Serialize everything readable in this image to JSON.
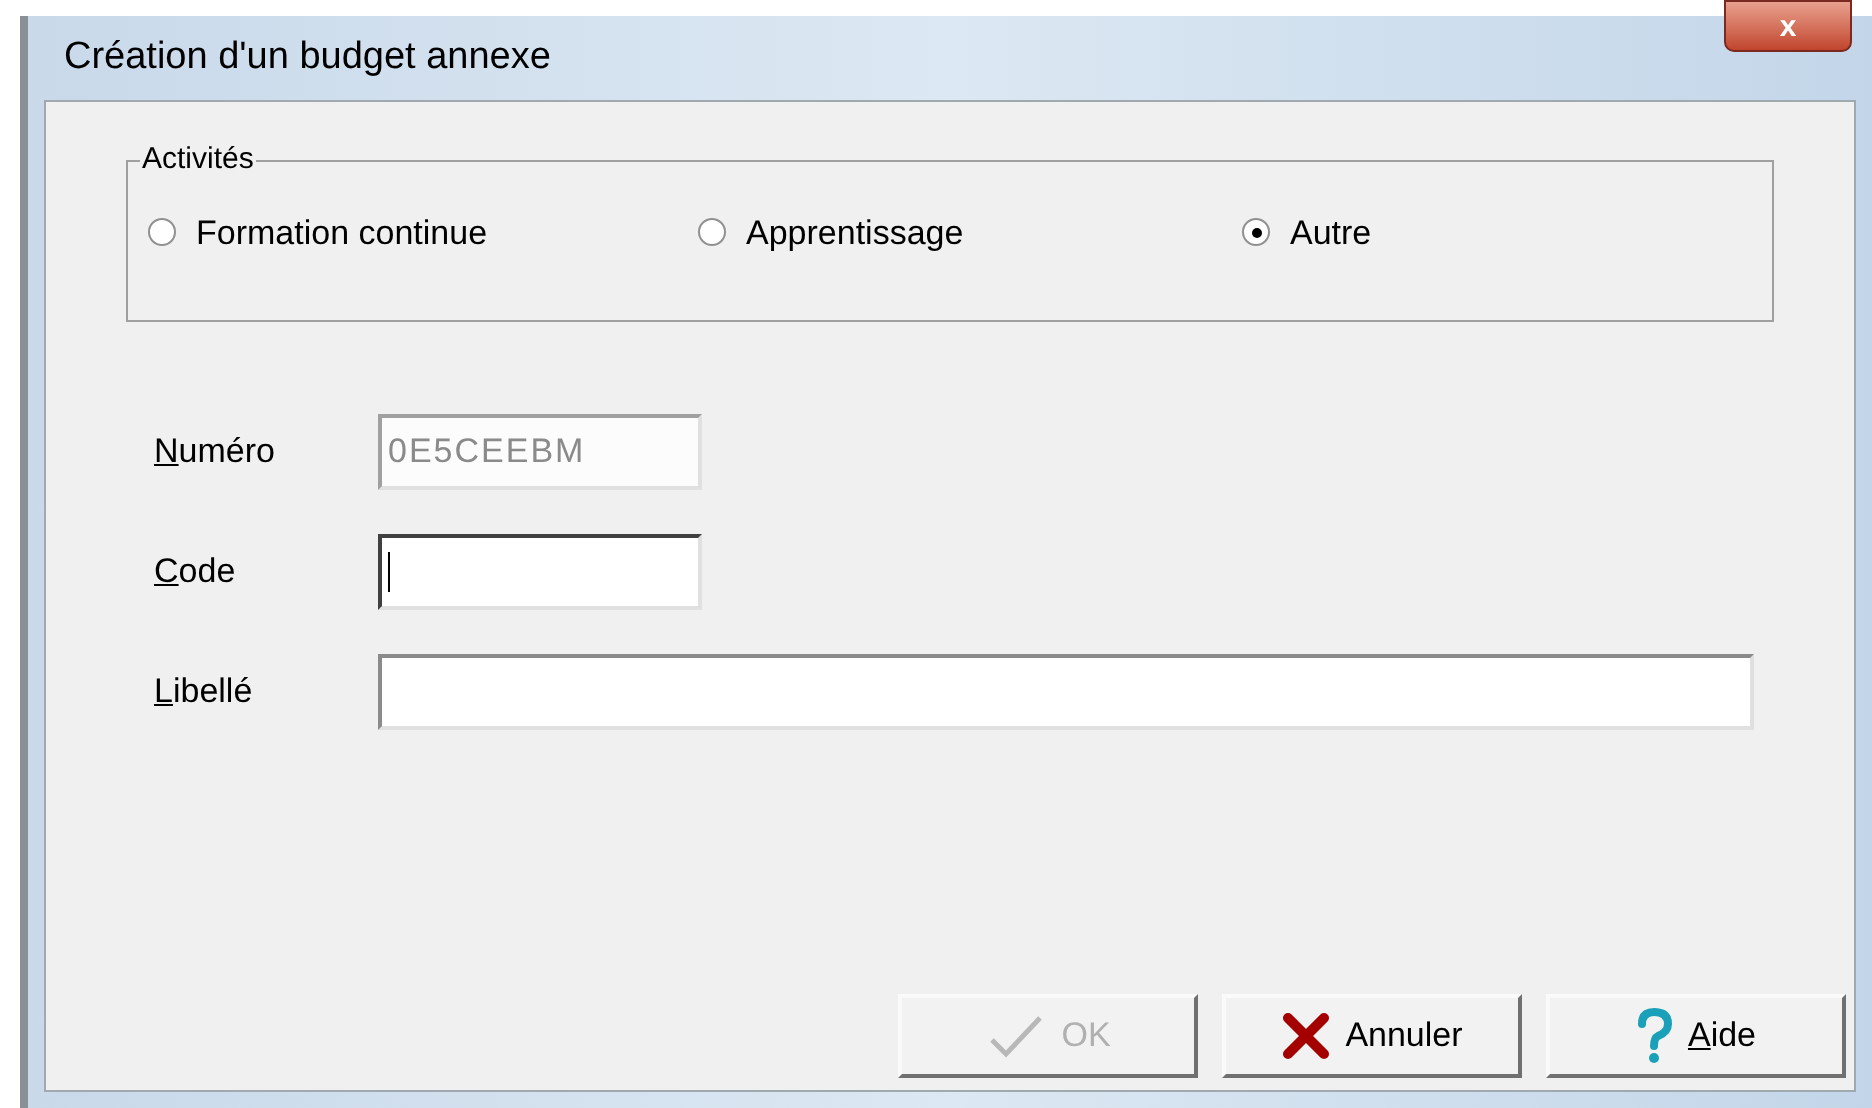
{
  "window": {
    "title": "Création d'un budget annexe",
    "close": "x"
  },
  "activities": {
    "legend": "Activités",
    "options": [
      {
        "label": "Formation continue",
        "selected": false
      },
      {
        "label": "Apprentissage",
        "selected": false
      },
      {
        "label": "Autre",
        "selected": true
      }
    ]
  },
  "fields": [
    {
      "label": "Numéro",
      "mnemonic": true,
      "value": "0E5CEEBM",
      "disabled": true,
      "focused": false,
      "wide": false
    },
    {
      "label": "Code",
      "mnemonic": true,
      "disabled": false,
      "focused": true,
      "wide": false
    },
    {
      "label": "Libellé",
      "mnemonic": true,
      "disabled": false,
      "focused": false,
      "wide": true
    }
  ],
  "buttons": [
    {
      "kind": "ok",
      "label": "OK",
      "mnemonic": false,
      "disabled": true
    },
    {
      "kind": "cancel",
      "label": "Annuler",
      "mnemonic": false,
      "disabled": false
    },
    {
      "kind": "help",
      "label": "Aide",
      "mnemonic": true,
      "disabled": false
    }
  ]
}
